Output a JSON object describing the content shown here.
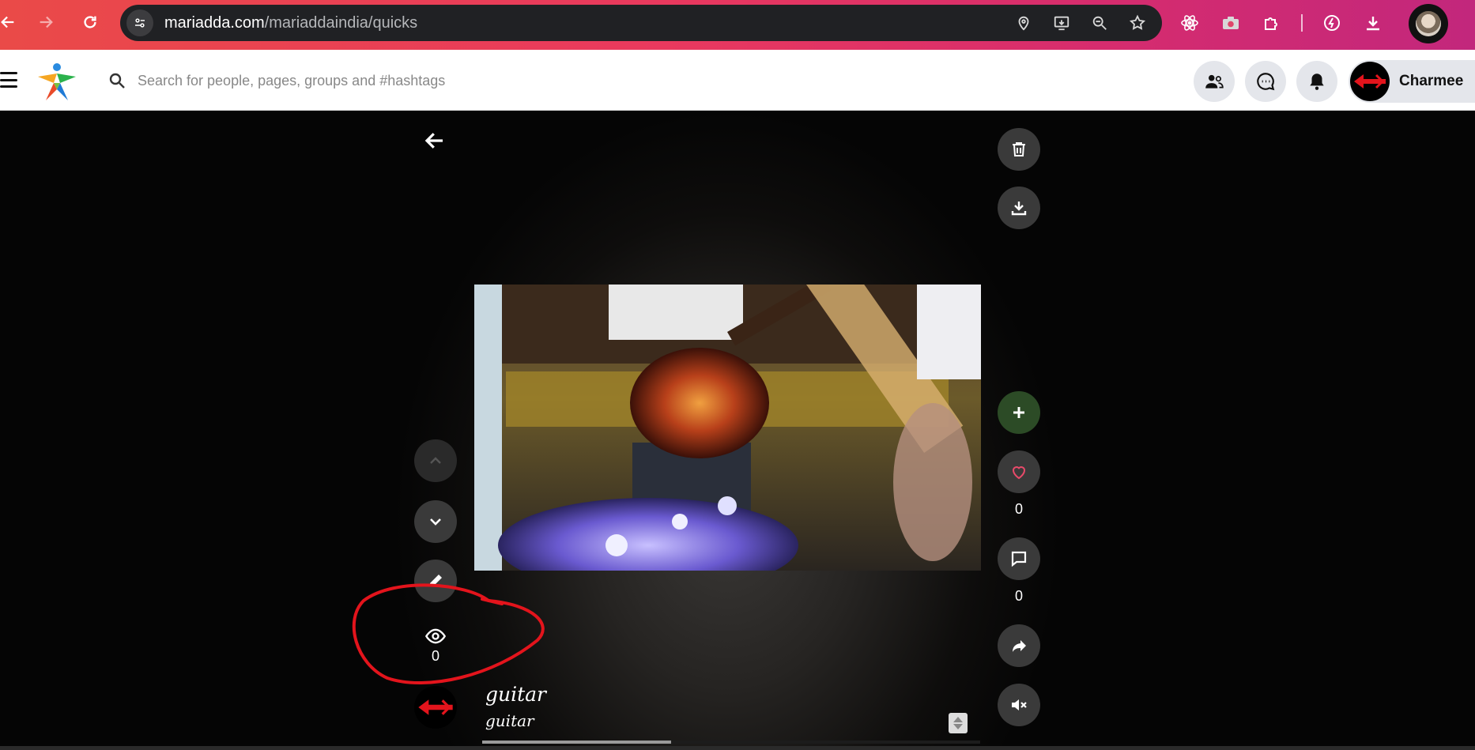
{
  "browser": {
    "url_domain": "mariadda.com",
    "url_path": "/mariaddaindia/quicks"
  },
  "header": {
    "search_placeholder": "Search for people, pages, groups and #hashtags",
    "user_name": "Charmee"
  },
  "quick": {
    "likes": "0",
    "comments": "0",
    "views": "0",
    "caption_title": "guitar",
    "caption_subtitle": "guitar",
    "progress": 0.38
  },
  "colors": {
    "browser_bar": "#e9395e",
    "annotation": "#e3141c",
    "add_button": "#2c4b26"
  },
  "icons": {
    "left_rail": [
      "chevron-up-icon",
      "chevron-down-icon",
      "edit-icon",
      "eye-icon"
    ],
    "right_rail": [
      "trash-icon",
      "download-icon",
      "plus-icon",
      "heart-icon",
      "comment-icon",
      "share-icon",
      "mute-icon"
    ]
  }
}
